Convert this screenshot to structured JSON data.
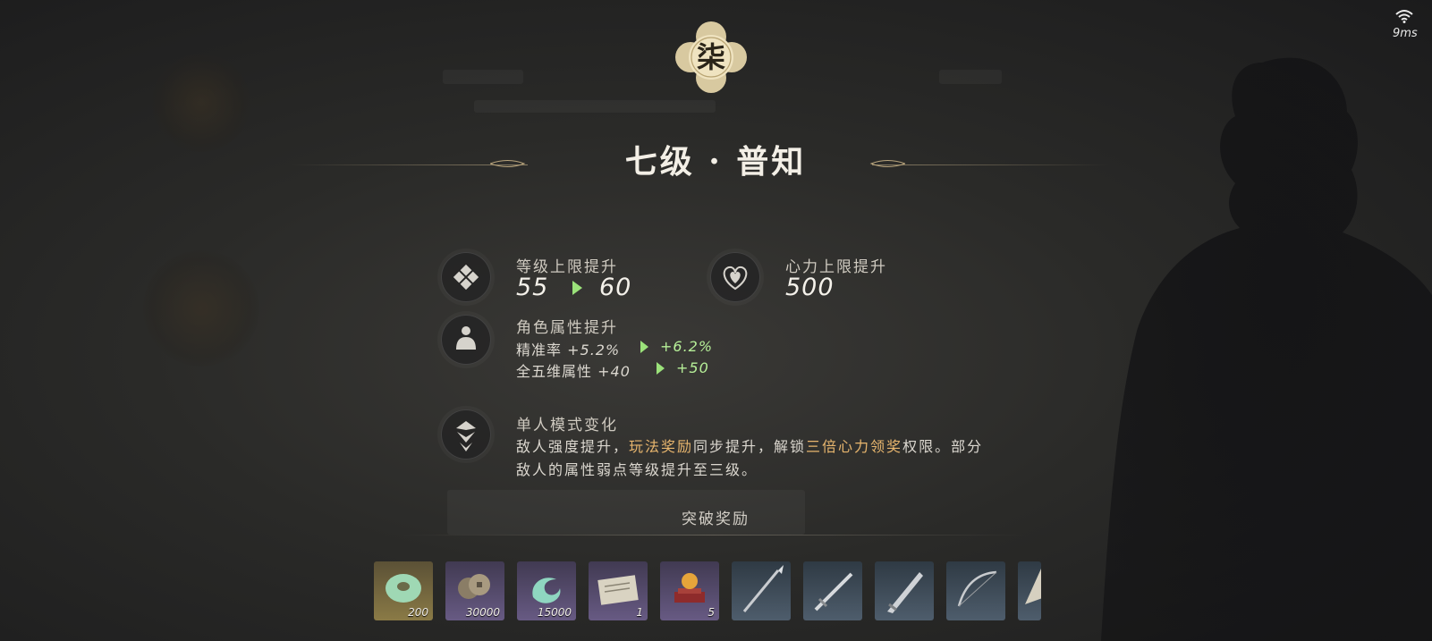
{
  "status": {
    "ping": "9ms",
    "wifi_icon": "wifi-icon"
  },
  "badge": {
    "glyph": "柒"
  },
  "title": "七级 · 普知",
  "stats": {
    "level_cap": {
      "label": "等级上限提升",
      "from": "55",
      "to": "60"
    },
    "stamina_cap": {
      "label": "心力上限提升",
      "value": "500"
    },
    "attributes": {
      "label": "角色属性提升",
      "lines": [
        {
          "name": "精准率",
          "from": "+5.2%",
          "to": "+6.2%"
        },
        {
          "name": "全五维属性",
          "from": "+40",
          "to": "+50"
        }
      ]
    },
    "solo_mode": {
      "label": "单人模式变化",
      "desc_1": "敌人强度提升，",
      "desc_hl_1": "玩法奖励",
      "desc_2": "同步提升，解锁",
      "desc_hl_2": "三倍心力领奖",
      "desc_3": "权限。部分",
      "desc_line2": "敌人的属性弱点等级提升至三级。"
    }
  },
  "rewards": {
    "title": "突破奖励",
    "items": [
      {
        "name": "jade-ring-icon",
        "count": "200",
        "rarity": "gold"
      },
      {
        "name": "coins-icon",
        "count": "30000",
        "rarity": "purple"
      },
      {
        "name": "jade-swirl-icon",
        "count": "15000",
        "rarity": "purple"
      },
      {
        "name": "scroll-icon",
        "count": "1",
        "rarity": "purple"
      },
      {
        "name": "orb-pedestal-icon",
        "count": "5",
        "rarity": "purple"
      },
      {
        "name": "spear-icon",
        "count": "",
        "rarity": "blue"
      },
      {
        "name": "sword-icon",
        "count": "",
        "rarity": "blue"
      },
      {
        "name": "blade-icon",
        "count": "",
        "rarity": "blue"
      },
      {
        "name": "bow-icon",
        "count": "",
        "rarity": "blue"
      },
      {
        "name": "fan-icon",
        "count": "",
        "rarity": "blue"
      }
    ]
  },
  "colors": {
    "highlight": "#e8b66e",
    "increase": "#b6ef98"
  }
}
